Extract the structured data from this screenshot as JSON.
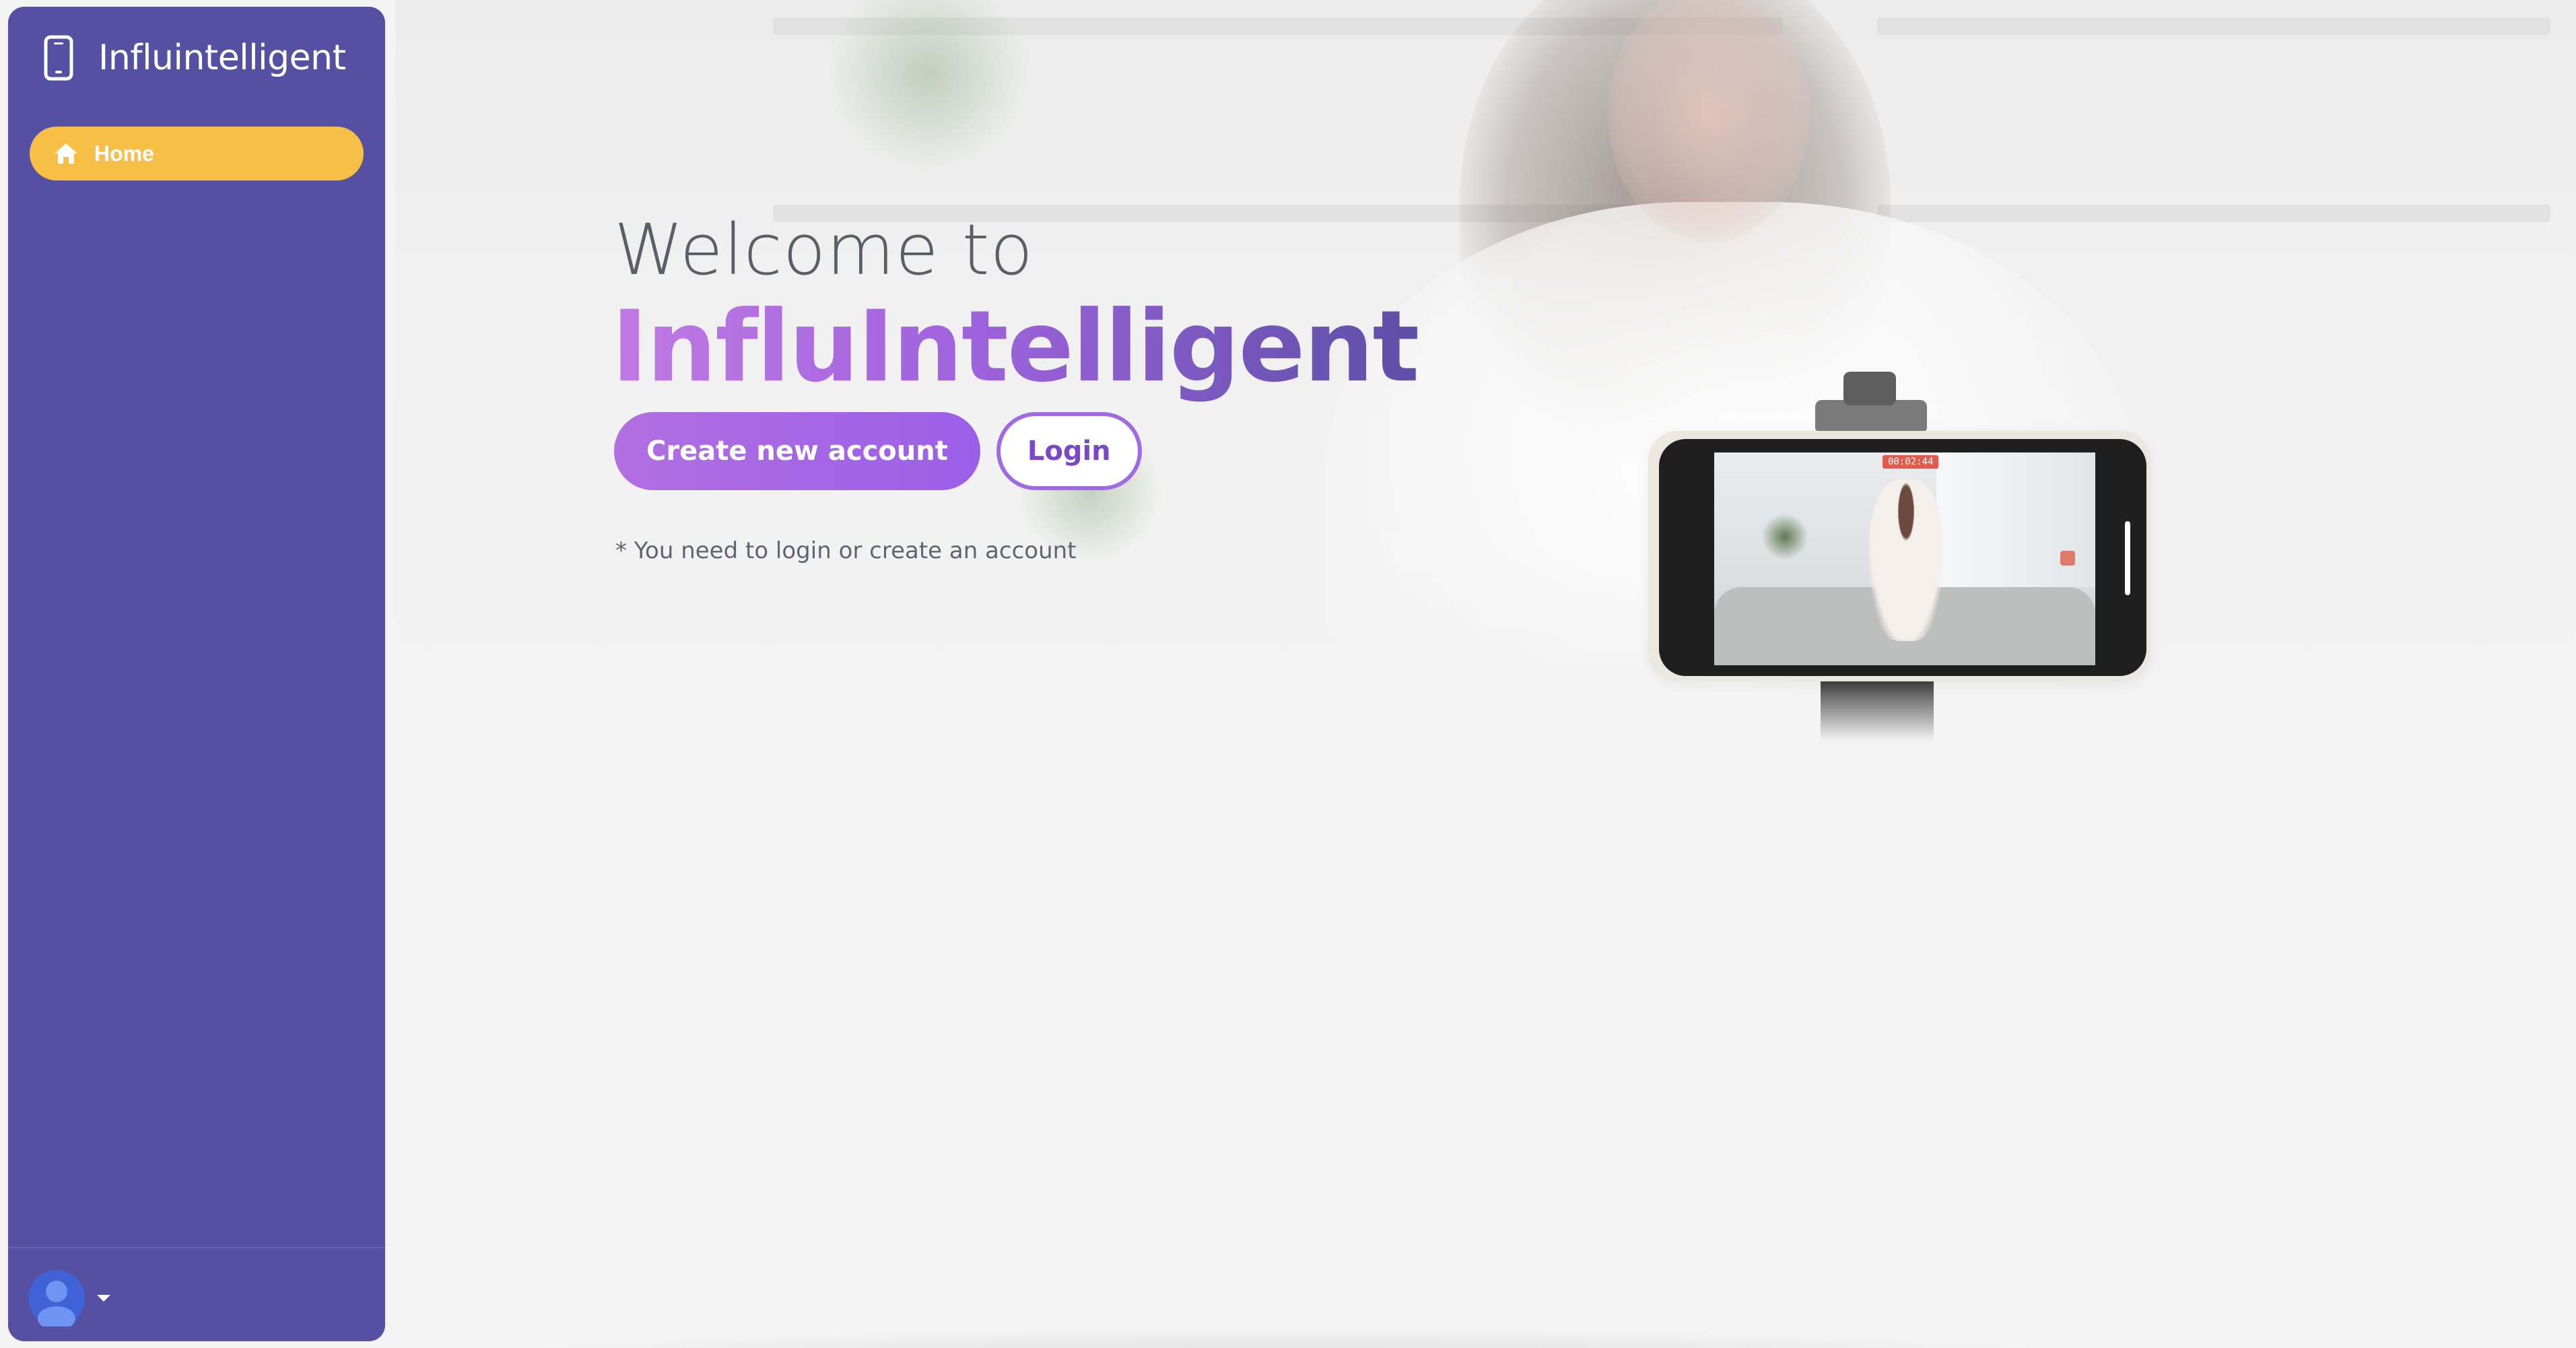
{
  "sidebar": {
    "brand_name": "Influintelligent",
    "brand_icon": "mobile-phone-icon",
    "items": [
      {
        "label": "Home",
        "icon": "home-icon",
        "active": true
      }
    ],
    "active_color": "#f7bf45",
    "background_color": "#5650a2",
    "user_menu": {
      "avatar_icon": "user-avatar-icon",
      "caret_icon": "caret-down-icon"
    }
  },
  "hero": {
    "welcome_text": "Welcome to",
    "headline": "InfluIntelligent",
    "create_button_label": "Create new account",
    "login_button_label": "Login",
    "notice": "* You need to login or create an account",
    "phone_recording_time": "00:02:44",
    "accent_gradient": [
      "#c07ae4",
      "#9e62dc",
      "#5c4fa6"
    ]
  }
}
